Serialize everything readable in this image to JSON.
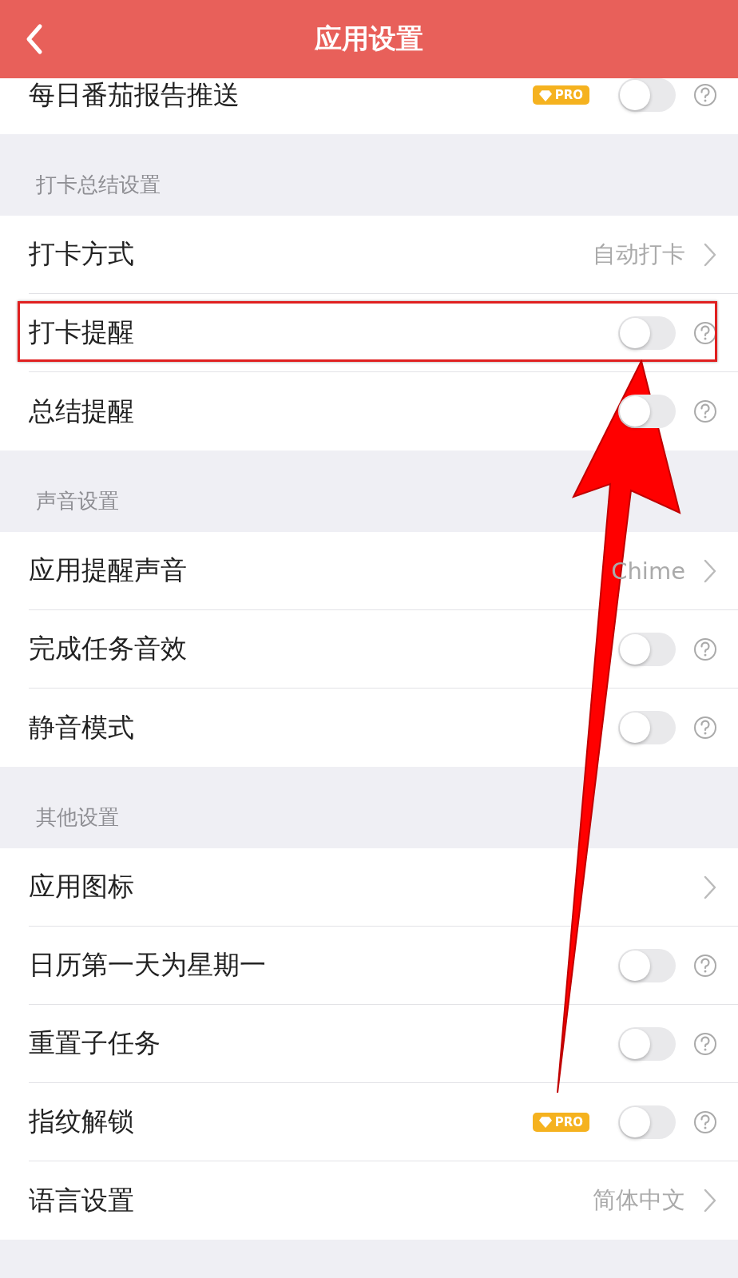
{
  "header": {
    "title": "应用设置"
  },
  "sections": [
    {
      "rows": [
        {
          "label": "每日番茄报告推送",
          "kind": "toggle",
          "on": false,
          "badge": "PRO",
          "highlighted": false
        }
      ]
    },
    {
      "title": "打卡总结设置",
      "rows": [
        {
          "label": "打卡方式",
          "kind": "link",
          "value": "自动打卡",
          "highlighted": false
        },
        {
          "label": "打卡提醒",
          "kind": "toggle",
          "on": false,
          "highlighted": true
        },
        {
          "label": "总结提醒",
          "kind": "toggle",
          "on": false,
          "highlighted": false
        }
      ]
    },
    {
      "title": "声音设置",
      "rows": [
        {
          "label": "应用提醒声音",
          "kind": "link",
          "value": "Chime",
          "highlighted": false
        },
        {
          "label": "完成任务音效",
          "kind": "toggle",
          "on": false,
          "highlighted": false
        },
        {
          "label": "静音模式",
          "kind": "toggle",
          "on": false,
          "highlighted": false
        }
      ]
    },
    {
      "title": "其他设置",
      "rows": [
        {
          "label": "应用图标",
          "kind": "link",
          "highlighted": false
        },
        {
          "label": "日历第一天为星期一",
          "kind": "toggle",
          "on": false,
          "highlighted": false
        },
        {
          "label": "重置子任务",
          "kind": "toggle",
          "on": false,
          "highlighted": false
        },
        {
          "label": "指纹解锁",
          "kind": "toggle",
          "on": false,
          "badge": "PRO",
          "highlighted": false
        },
        {
          "label": "语言设置",
          "kind": "link",
          "value": "简体中文",
          "highlighted": false
        }
      ]
    }
  ]
}
